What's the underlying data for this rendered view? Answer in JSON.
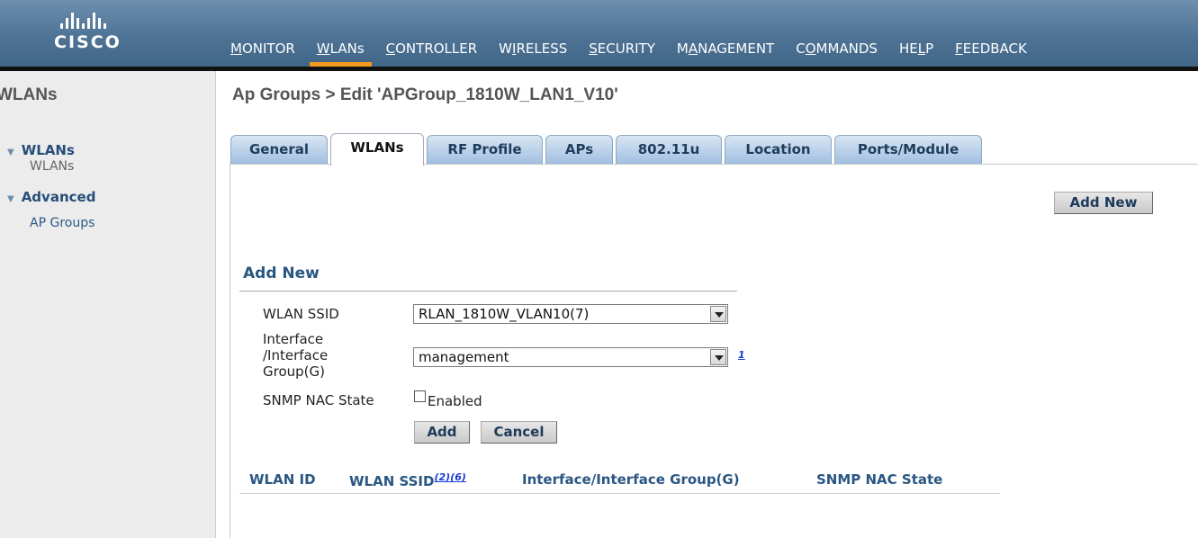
{
  "brand": {
    "logo_text": "CISCO"
  },
  "topnav": [
    {
      "label": "MONITOR",
      "ul": "M",
      "rest": "ONITOR",
      "active": false
    },
    {
      "label": "WLANs",
      "ul": "W",
      "rest": "LANs",
      "active": true
    },
    {
      "label": "CONTROLLER",
      "ul": "C",
      "rest": "ONTROLLER",
      "active": false
    },
    {
      "label": "WIRELESS",
      "pre": "W",
      "ul": "I",
      "rest": "RELESS",
      "active": false
    },
    {
      "label": "SECURITY",
      "ul": "S",
      "rest": "ECURITY",
      "active": false
    },
    {
      "label": "MANAGEMENT",
      "pre": "M",
      "ul": "A",
      "rest": "NAGEMENT",
      "active": false
    },
    {
      "label": "COMMANDS",
      "pre": "C",
      "ul": "O",
      "rest": "MMANDS",
      "active": false
    },
    {
      "label": "HELP",
      "pre": "HE",
      "ul": "L",
      "rest": "P",
      "active": false
    },
    {
      "label": "FEEDBACK",
      "ul": "F",
      "rest": "EEDBACK",
      "active": false
    }
  ],
  "sidebar": {
    "title": "WLANs",
    "section_wlans": "WLANs",
    "item_wlans": "WLANs",
    "section_advanced": "Advanced",
    "item_ap_groups": "AP Groups"
  },
  "page": {
    "title": "Ap Groups > Edit  'APGroup_1810W_LAN1_V10'"
  },
  "tabs": [
    "General",
    "WLANs",
    "RF Profile",
    "APs",
    "802.11u",
    "Location",
    "Ports/Module"
  ],
  "active_tab": "WLANs",
  "buttons": {
    "add_new": "Add New",
    "add": "Add",
    "cancel": "Cancel"
  },
  "form": {
    "section_title": "Add New",
    "wlan_ssid_label": "WLAN SSID",
    "wlan_ssid_value": "RLAN_1810W_VLAN10(7)",
    "interface_label_1": "Interface",
    "interface_label_2": "/Interface",
    "interface_label_3": "Group(G)",
    "interface_value": "management",
    "interface_help": "1",
    "snmp_label": "SNMP NAC State",
    "snmp_checkbox_label": "Enabled",
    "snmp_checked": false
  },
  "table": {
    "headers": {
      "wlan_id": "WLAN ID",
      "wlan_ssid": "WLAN SSID",
      "wlan_ssid_sup": "(2)(6)",
      "interface": "Interface/Interface Group(G)",
      "snmp": "SNMP NAC State"
    },
    "rows": []
  },
  "colors": {
    "header_blue": "#4d7294",
    "accent_orange": "#f39a1e",
    "link_blue": "#2a5682"
  }
}
